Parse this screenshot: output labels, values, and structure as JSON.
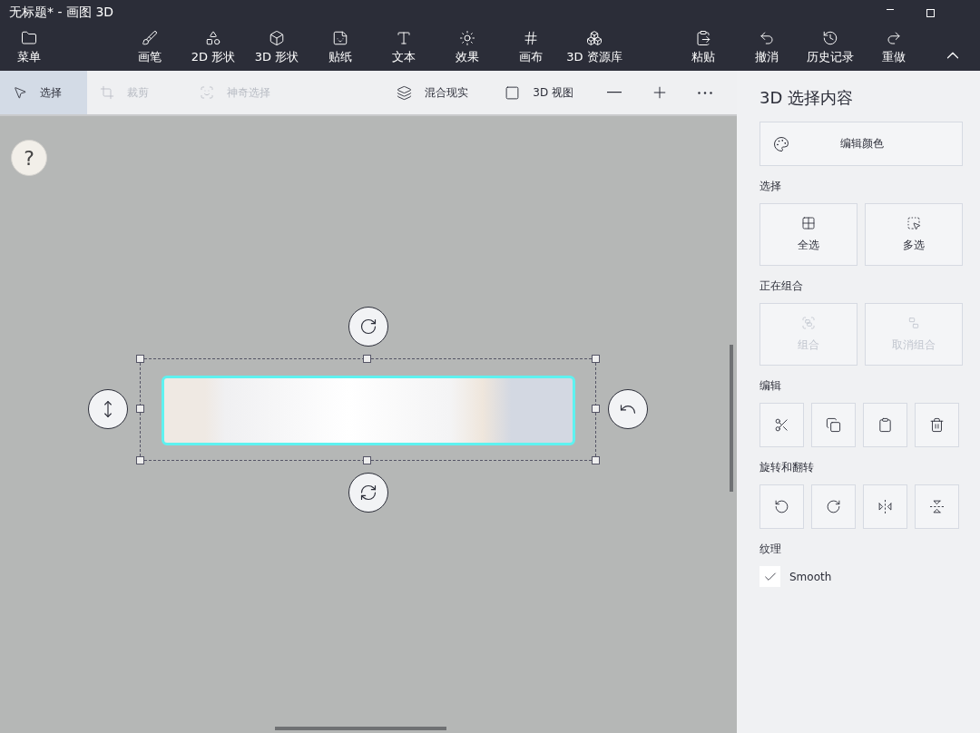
{
  "window": {
    "title": "无标题* - 画图 3D"
  },
  "toolbar": {
    "menu": {
      "label": "菜单"
    },
    "tools": [
      {
        "label": "画笔"
      },
      {
        "label": "2D 形状"
      },
      {
        "label": "3D 形状"
      },
      {
        "label": "贴纸"
      },
      {
        "label": "文本"
      },
      {
        "label": "效果"
      },
      {
        "label": "画布"
      },
      {
        "label": "3D 资源库"
      }
    ],
    "actions": [
      {
        "label": "粘贴"
      },
      {
        "label": "撤消"
      },
      {
        "label": "历史记录"
      },
      {
        "label": "重做"
      }
    ]
  },
  "subbar": {
    "tools": [
      {
        "label": "选择",
        "selected": true,
        "disabled": false
      },
      {
        "label": "裁剪",
        "selected": false,
        "disabled": true
      },
      {
        "label": "神奇选择",
        "selected": false,
        "disabled": true
      }
    ],
    "views": [
      {
        "label": "混合现实"
      },
      {
        "label": "3D 视图"
      }
    ]
  },
  "canvas": {
    "help": "?"
  },
  "panel": {
    "title": "3D 选择内容",
    "edit_color": "编辑颜色",
    "select": {
      "heading": "选择",
      "buttons": [
        {
          "label": "全选",
          "disabled": false
        },
        {
          "label": "多选",
          "disabled": false
        }
      ]
    },
    "group": {
      "heading": "正在组合",
      "buttons": [
        {
          "label": "组合",
          "disabled": true
        },
        {
          "label": "取消组合",
          "disabled": true
        }
      ]
    },
    "edit": {
      "heading": "编辑"
    },
    "rotate": {
      "heading": "旋转和翻转"
    },
    "texture": {
      "heading": "纹理",
      "smooth": {
        "label": "Smooth",
        "checked": true
      }
    }
  }
}
